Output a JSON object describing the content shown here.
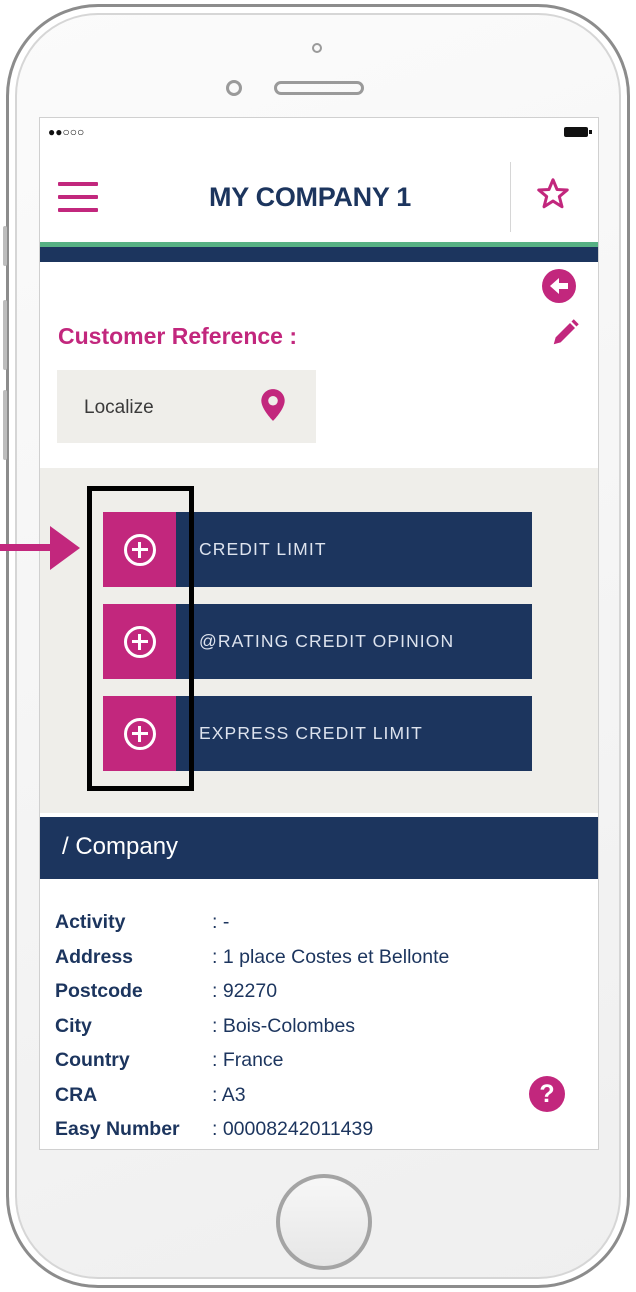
{
  "app": {
    "title": "MY COMPANY 1",
    "colors": {
      "brand_pink": "#c2277d",
      "navy": "#1c355e",
      "accent_green": "#57b184",
      "panel_bg": "#efeeea"
    }
  },
  "status_bar": {
    "signal": "●●○○○"
  },
  "customer_reference": {
    "label": "Customer Reference :"
  },
  "localize": {
    "label": "Localize",
    "icon": "map-pin-icon"
  },
  "actions": [
    {
      "label": "CREDIT LIMIT",
      "icon": "add-circle-icon"
    },
    {
      "label": "@RATING CREDIT OPINION",
      "icon": "add-circle-icon"
    },
    {
      "label": "EXPRESS CREDIT LIMIT",
      "icon": "add-circle-icon"
    }
  ],
  "company_section": {
    "title": "/ Company",
    "details": [
      {
        "label": "Activity",
        "value": ": -"
      },
      {
        "label": "Address",
        "value": ": 1 place Costes et Bellonte"
      },
      {
        "label": "Postcode",
        "value": ": 92270"
      },
      {
        "label": "City",
        "value": ": Bois-Colombes"
      },
      {
        "label": "Country",
        "value": ": France"
      },
      {
        "label": "CRA",
        "value": ": A3"
      },
      {
        "label": "Easy Number",
        "value": ": 00008242011439"
      }
    ]
  },
  "help": {
    "symbol": "?"
  }
}
